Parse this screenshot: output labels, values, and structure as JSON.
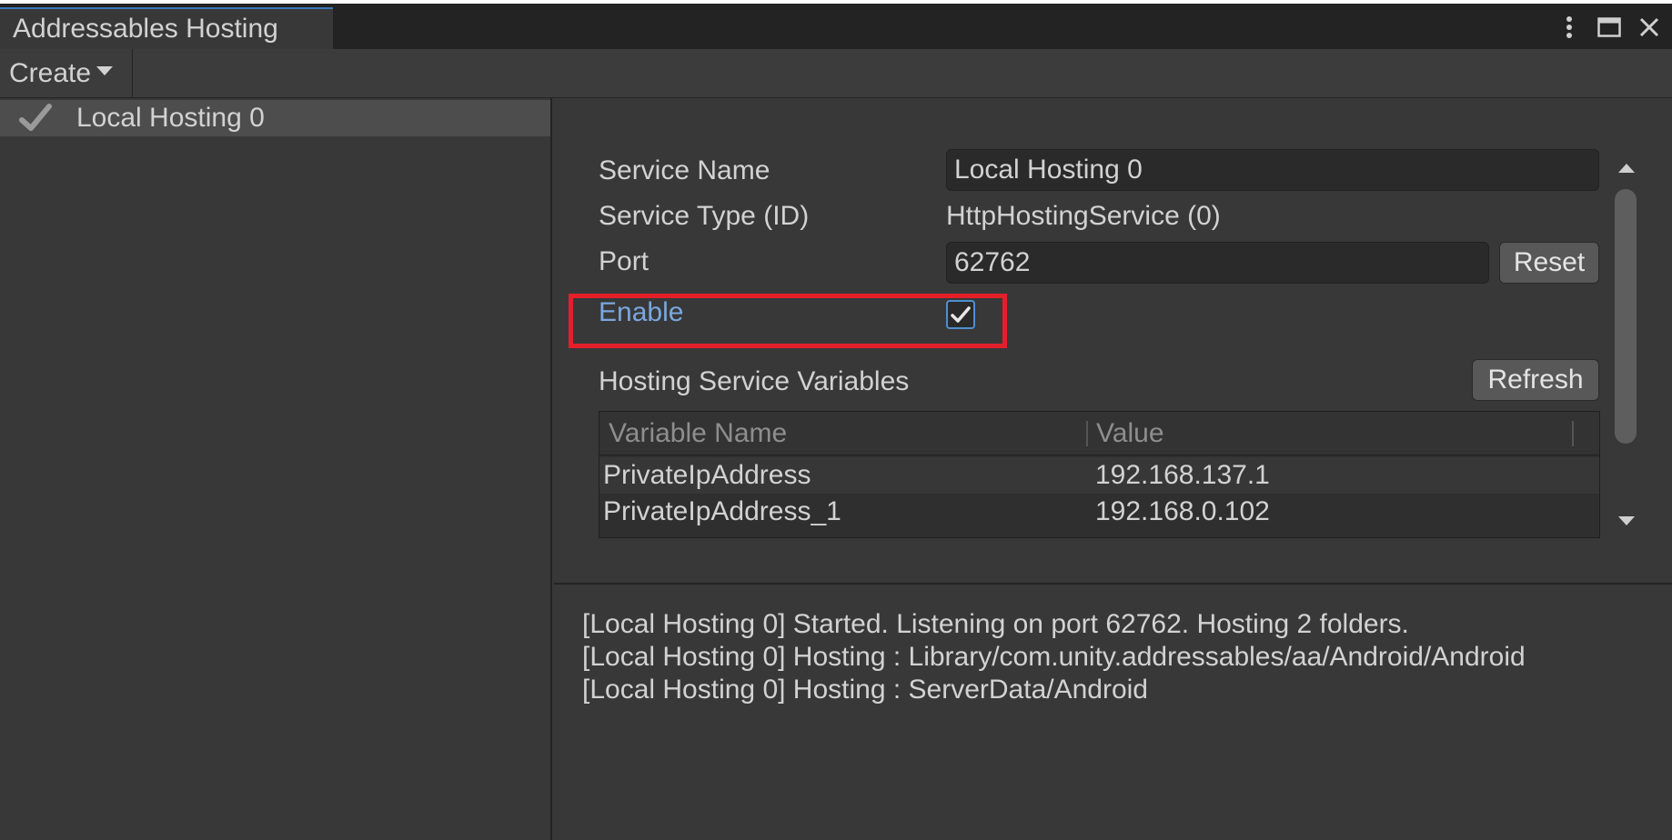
{
  "window": {
    "tab_title": "Addressables Hosting"
  },
  "toolbar": {
    "create_label": "Create"
  },
  "services": [
    {
      "label": "Local Hosting 0",
      "icon": "checkmark-icon",
      "selected": true
    }
  ],
  "inspector": {
    "service_name_label": "Service Name",
    "service_name_value": "Local Hosting 0",
    "service_type_label": "Service Type (ID)",
    "service_type_value": "HttpHostingService (0)",
    "port_label": "Port",
    "port_value": "62762",
    "reset_label": "Reset",
    "enable_label": "Enable",
    "enable_checked": true,
    "variables_label": "Hosting Service Variables",
    "refresh_label": "Refresh",
    "table": {
      "columns": [
        "Variable Name",
        "Value"
      ],
      "rows": [
        {
          "name": "PrivateIpAddress",
          "value": "192.168.137.1"
        },
        {
          "name": "PrivateIpAddress_1",
          "value": "192.168.0.102"
        }
      ]
    }
  },
  "log": [
    "[Local Hosting 0] Started. Listening on port 62762. Hosting 2 folders.",
    "[Local Hosting 0] Hosting : Library/com.unity.addressables/aa/Android/Android",
    "[Local Hosting 0] Hosting : ServerData/Android"
  ],
  "colors": {
    "background": "#383838",
    "highlight_border": "#e3202a",
    "enable_label": "#7aa7e0",
    "tab_accent": "#3a79bb"
  }
}
